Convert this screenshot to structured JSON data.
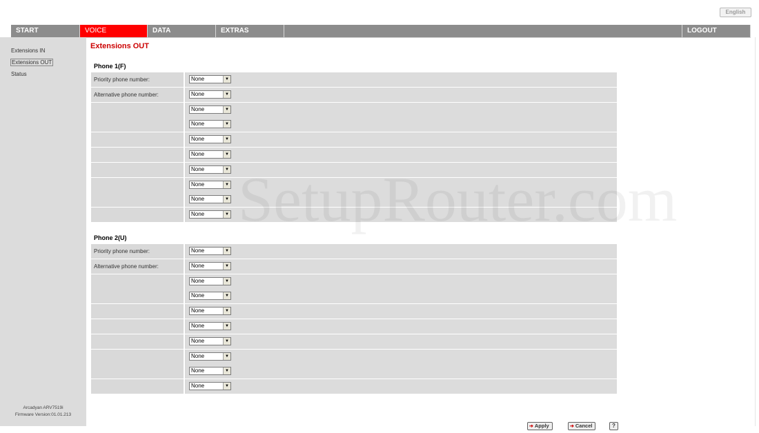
{
  "language_button": "English",
  "nav": [
    {
      "label": "START",
      "active": false
    },
    {
      "label": "VOICE",
      "active": true
    },
    {
      "label": "DATA",
      "active": false
    },
    {
      "label": "EXTRAS",
      "active": false
    }
  ],
  "logout_label": "LOGOUT",
  "sidebar": {
    "items": [
      {
        "label": "Extensions IN",
        "selected": false
      },
      {
        "label": "Extensions OUT",
        "selected": true
      },
      {
        "label": "Status",
        "selected": false
      }
    ],
    "device": "Arcadyan ARV7519i",
    "firmware": "Firmware Version:01.01.213"
  },
  "page_title": "Extensions OUT",
  "phone1": {
    "title": "Phone 1(F)",
    "rows": [
      {
        "label": "Priority phone number:",
        "value": "None"
      },
      {
        "label": "Alternative phone number:",
        "value": "None"
      },
      {
        "label": "",
        "value": "None"
      },
      {
        "label": "",
        "value": "None"
      },
      {
        "label": "",
        "value": "None"
      },
      {
        "label": "",
        "value": "None"
      },
      {
        "label": "",
        "value": "None"
      },
      {
        "label": "",
        "value": "None"
      },
      {
        "label": "",
        "value": "None"
      },
      {
        "label": "",
        "value": "None"
      }
    ]
  },
  "phone2": {
    "title": "Phone 2(U)",
    "rows": [
      {
        "label": "Priority phone number:",
        "value": "None"
      },
      {
        "label": "Alternative phone number:",
        "value": "None"
      },
      {
        "label": "",
        "value": "None"
      },
      {
        "label": "",
        "value": "None"
      },
      {
        "label": "",
        "value": "None"
      },
      {
        "label": "",
        "value": "None"
      },
      {
        "label": "",
        "value": "None"
      },
      {
        "label": "",
        "value": "None"
      },
      {
        "label": "",
        "value": "None"
      },
      {
        "label": "",
        "value": "None"
      }
    ]
  },
  "buttons": {
    "apply": "Apply",
    "cancel": "Cancel",
    "help": "?"
  },
  "watermark": "SetupRouter.com",
  "colors": {
    "accent": "#ff0000",
    "title": "#cc0000",
    "nav_bg": "#8c8c8c",
    "sidebar_bg": "#dcdcdc",
    "row_bg": "#d9d9d9"
  }
}
